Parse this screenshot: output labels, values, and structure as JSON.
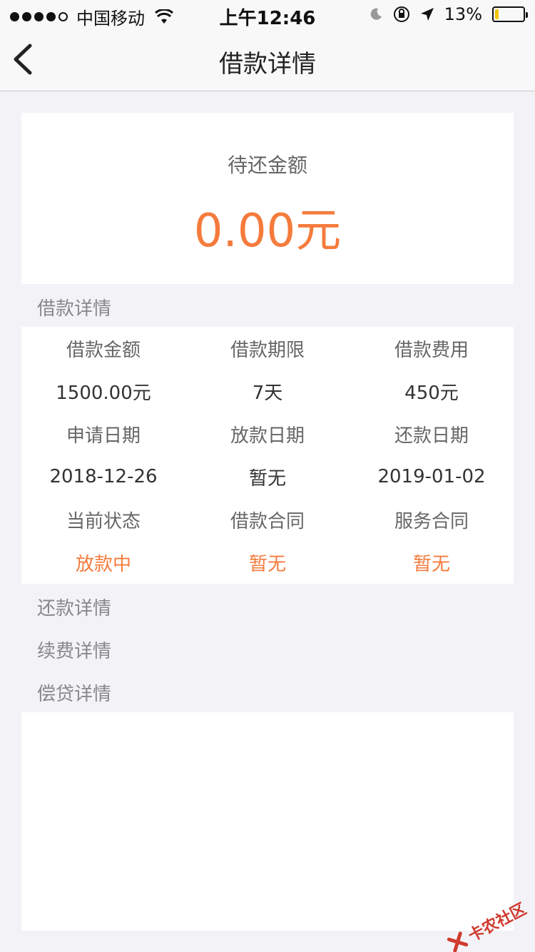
{
  "status_bar": {
    "carrier": "中国移动",
    "time": "上午12:46",
    "battery_percent": "13%",
    "battery_level": 0.13
  },
  "nav": {
    "title": "借款详情"
  },
  "amount": {
    "label": "待还金额",
    "value": "0.00元"
  },
  "sections": {
    "loan_details": "借款详情",
    "repayment_details": "还款详情",
    "renewal_details": "续费详情",
    "compensation_details": "偿贷详情"
  },
  "details": {
    "row1_labels": [
      "借款金额",
      "借款期限",
      "借款费用"
    ],
    "row1_values": [
      "1500.00元",
      "7天",
      "450元"
    ],
    "row2_labels": [
      "申请日期",
      "放款日期",
      "还款日期"
    ],
    "row2_values": [
      "2018-12-26",
      "暂无",
      "2019-01-02"
    ],
    "row3_labels": [
      "当前状态",
      "借款合同",
      "服务合同"
    ],
    "row3_values": [
      "放款中",
      "暂无",
      "暂无"
    ]
  },
  "watermark": {
    "text": "卡农社区"
  },
  "colors": {
    "accent": "#f57b3c",
    "background": "#f3f3f7"
  }
}
